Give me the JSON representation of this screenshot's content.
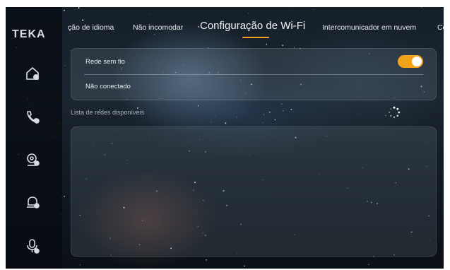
{
  "brand": {
    "logo": "TEKA"
  },
  "sidebar": {
    "items": [
      {
        "icon": "home-icon"
      },
      {
        "icon": "phone-icon"
      },
      {
        "icon": "camera-icon"
      },
      {
        "icon": "bell-icon"
      },
      {
        "icon": "mic-icon"
      }
    ]
  },
  "tabs": [
    {
      "label": "ção de idioma"
    },
    {
      "label": "Não incomodar"
    },
    {
      "label": "Configuração de Wi-Fi",
      "active": true
    },
    {
      "label": "Intercomunicador em nuvem"
    },
    {
      "label": "Co"
    }
  ],
  "wifi": {
    "toggle_label": "Rede sem fio",
    "enabled": true,
    "status": "Não conectado"
  },
  "networks": {
    "title": "Lista de redes disponíveis",
    "loading": true,
    "items": []
  },
  "colors": {
    "accent": "#f3a21c"
  }
}
